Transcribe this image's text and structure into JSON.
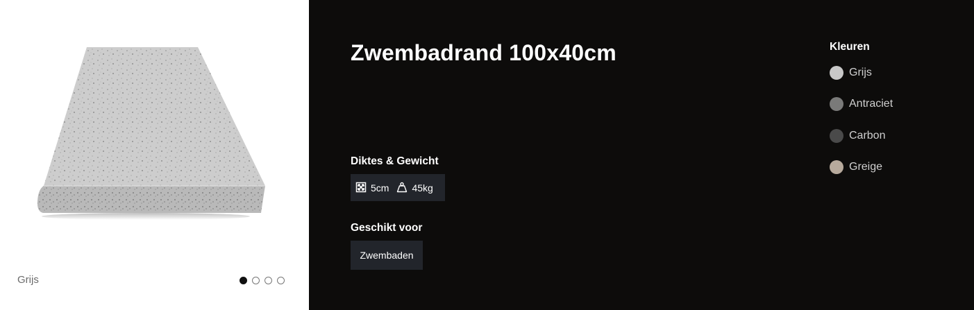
{
  "gallery": {
    "caption": "Grijs",
    "slide_count": 4,
    "active_slide": 0
  },
  "product": {
    "title": "Zwembadrand 100x40cm"
  },
  "specs": {
    "label": "Diktes & Gewicht",
    "thickness": "5cm",
    "thickness_icon": "expand-arrows-icon",
    "weight": "45kg",
    "weight_icon": "weight-icon"
  },
  "suitable": {
    "label": "Geschikt voor",
    "items": [
      "Zwembaden"
    ]
  },
  "colors": {
    "title": "Kleuren",
    "options": [
      {
        "label": "Grijs",
        "hex": "#c8c8c8"
      },
      {
        "label": "Antraciet",
        "hex": "#7a7a79"
      },
      {
        "label": "Carbon",
        "hex": "#4a4a4a"
      },
      {
        "label": "Greige",
        "hex": "#b7aa9c"
      }
    ]
  },
  "theme": {
    "panel_bg": "#0d0c0b",
    "chip_bg": "#22252b"
  }
}
